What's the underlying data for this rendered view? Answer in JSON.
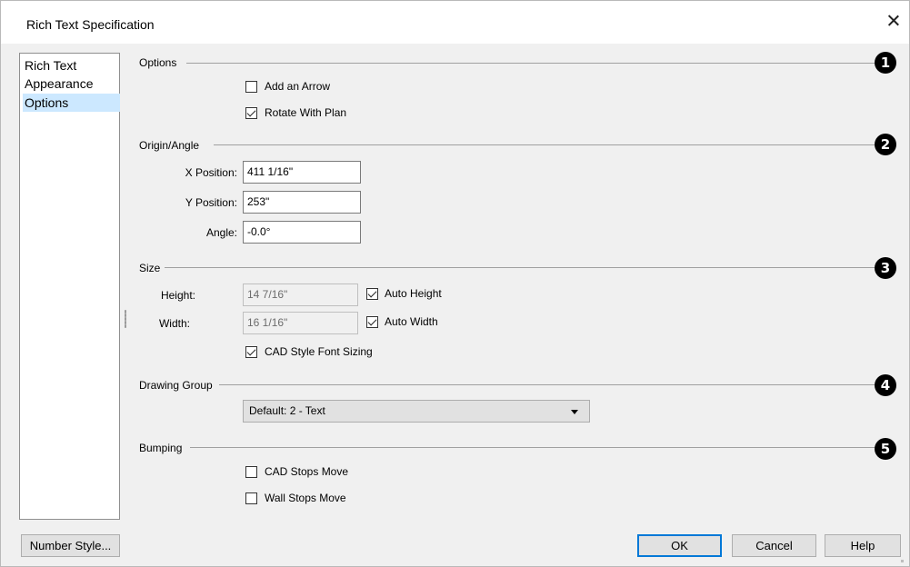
{
  "window": {
    "title": "Rich Text Specification"
  },
  "nav": {
    "items": [
      {
        "label": "Rich Text"
      },
      {
        "label": "Appearance"
      },
      {
        "label": "Options"
      }
    ]
  },
  "sections": {
    "options": {
      "label": "Options",
      "badge": "1",
      "add_arrow": "Add an Arrow",
      "add_arrow_checked": false,
      "rotate_with_plan": "Rotate With Plan",
      "rotate_with_plan_checked": true
    },
    "origin": {
      "label": "Origin/Angle",
      "badge": "2",
      "x_label": "X Position:",
      "x_value": "411 1/16\"",
      "y_label": "Y Position:",
      "y_value": "253\"",
      "angle_label": "Angle:",
      "angle_value": "-0.0°"
    },
    "size": {
      "label": "Size",
      "badge": "3",
      "height_label": "Height:",
      "height_value": "14 7/16\"",
      "auto_height": "Auto Height",
      "auto_height_checked": true,
      "width_label": "Width:",
      "width_value": "16 1/16\"",
      "auto_width": "Auto Width",
      "auto_width_checked": true,
      "cad_font": "CAD Style Font Sizing",
      "cad_font_checked": true
    },
    "drawing_group": {
      "label": "Drawing Group",
      "badge": "4",
      "selected": "Default: 2 - Text"
    },
    "bumping": {
      "label": "Bumping",
      "badge": "5",
      "cad_stops": "CAD Stops Move",
      "cad_stops_checked": false,
      "wall_stops": "Wall Stops Move",
      "wall_stops_checked": false
    }
  },
  "buttons": {
    "number_style": "Number Style...",
    "ok": "OK",
    "cancel": "Cancel",
    "help": "Help"
  },
  "icons": {
    "close": "close-icon",
    "dropdown": "chevron-down-icon"
  },
  "colors": {
    "selection": "#cce8ff",
    "default_button_border": "#0078d7"
  }
}
